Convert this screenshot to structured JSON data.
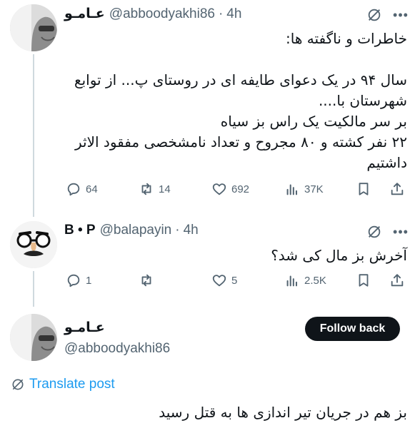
{
  "tweet1": {
    "name": "عـامـو",
    "handle": "@abboodyakhi86",
    "separator": "·",
    "time": "4h",
    "lines": [
      "خاطرات و ناگفته ها:",
      "",
      "سال ۹۴ در یک دعوای طایفه ای در روستای پ... از توابع",
      "شهرستان با....",
      "بر سر مالکیت یک راس بز سیاه",
      "۲۲ نفر کشته و ۸۰ مجروح و تعداد نامشخصی مفقود الاثر",
      "داشتیم"
    ],
    "stats": {
      "replies": "64",
      "reposts": "14",
      "likes": "692",
      "views": "37K"
    }
  },
  "tweet2": {
    "name": "B • P",
    "handle": "@balapayin",
    "separator": "·",
    "time": "4h",
    "lines": [
      "آخرش بز مال کی شد؟"
    ],
    "stats": {
      "replies": "1",
      "reposts": "",
      "likes": "5",
      "views": "2.5K"
    }
  },
  "tweet3": {
    "name": "عـامـو",
    "handle": "@abboodyakhi86",
    "follow_label": "Follow back",
    "translate_label": "Translate post",
    "lines": [
      "بز هم در جریان تیر اندازی ها به قتل رسید"
    ]
  },
  "icons": {
    "reply": "reply-icon",
    "repost": "repost-icon",
    "like": "heart-icon",
    "views": "views-icon",
    "bookmark": "bookmark-icon",
    "share": "share-icon",
    "grok": "grok-icon",
    "more": "more-icon",
    "globe": "globe-icon"
  },
  "colors": {
    "text": "#0f1419",
    "muted": "#536471",
    "link": "#1d9bf0",
    "button": "#0f1419",
    "thread_line": "#cfd9de"
  }
}
